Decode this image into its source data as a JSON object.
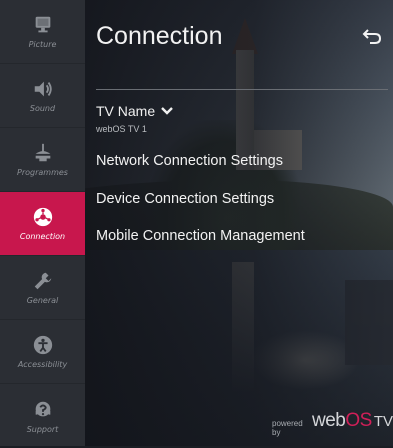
{
  "sidebar": {
    "items": [
      {
        "label": "Picture",
        "icon": "picture-icon",
        "active": false
      },
      {
        "label": "Sound",
        "icon": "sound-icon",
        "active": false
      },
      {
        "label": "Programmes",
        "icon": "programmes-icon",
        "active": false
      },
      {
        "label": "Connection",
        "icon": "connection-icon",
        "active": true
      },
      {
        "label": "General",
        "icon": "wrench-icon",
        "active": false
      },
      {
        "label": "Accessibility",
        "icon": "accessibility-icon",
        "active": false
      },
      {
        "label": "Support",
        "icon": "support-icon",
        "active": false
      }
    ]
  },
  "header": {
    "title": "Connection"
  },
  "tv_name": {
    "label": "TV Name",
    "value": "webOS TV 1"
  },
  "menu": {
    "items": [
      "Network Connection Settings",
      "Device Connection Settings",
      "Mobile Connection Management"
    ]
  },
  "branding": {
    "prefix": "powered by",
    "web": "web",
    "os": "OS",
    "tv": "TV"
  },
  "colors": {
    "accent": "#c8174d",
    "rail_background": "#2b2e34",
    "text_primary": "#f2f2f2"
  }
}
